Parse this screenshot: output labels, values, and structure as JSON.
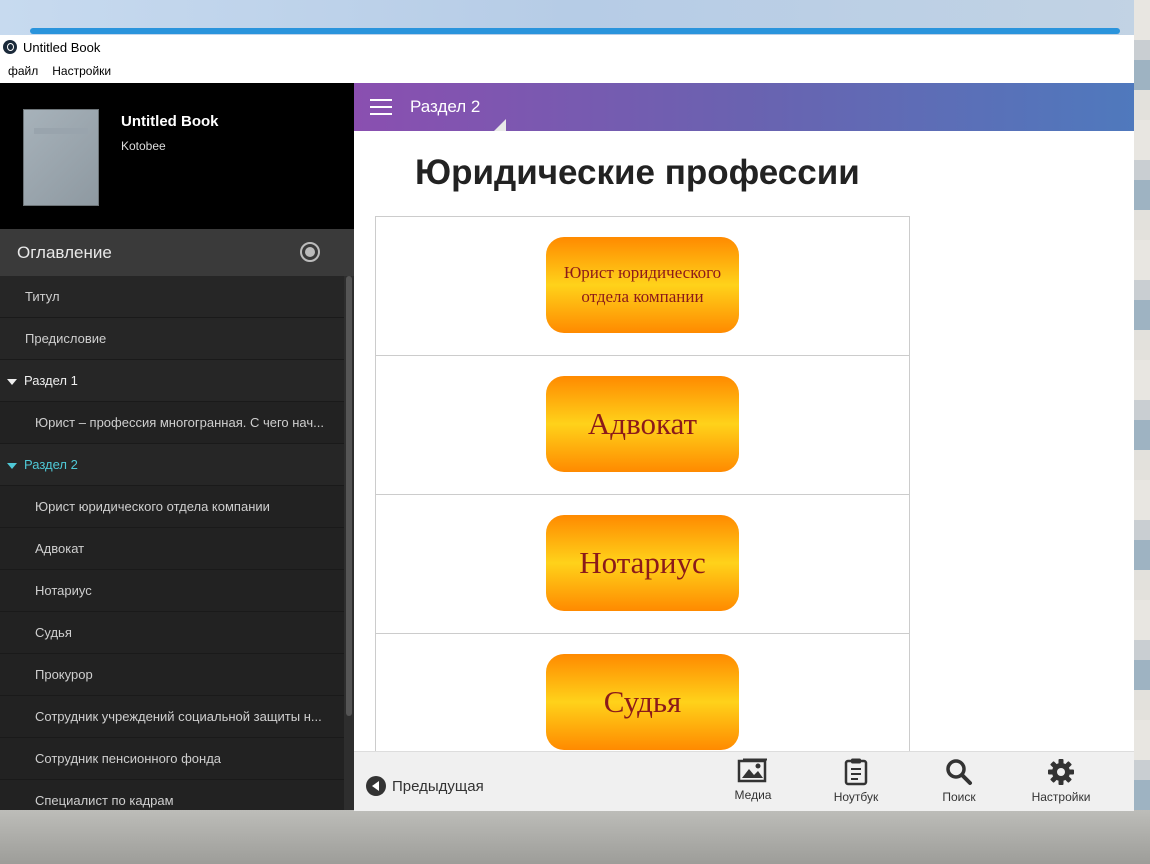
{
  "window": {
    "title": "Untitled Book"
  },
  "menu": [
    "файл",
    "Настройки"
  ],
  "book": {
    "title": "Untitled Book",
    "author": "Kotobee"
  },
  "toc": {
    "heading": "Оглавление",
    "items": [
      {
        "label": "Титул",
        "level": "top"
      },
      {
        "label": "Предисловие",
        "level": "top"
      },
      {
        "label": "Раздел 1",
        "level": "section"
      },
      {
        "label": "Юрист – профессия многогранная. С чего нач...",
        "level": "sub"
      },
      {
        "label": "Раздел 2",
        "level": "section-active"
      },
      {
        "label": "Юрист юридического отдела компании",
        "level": "sub"
      },
      {
        "label": "Адвокат",
        "level": "sub"
      },
      {
        "label": "Нотариус",
        "level": "sub"
      },
      {
        "label": "Судья",
        "level": "sub"
      },
      {
        "label": "Прокурор",
        "level": "sub"
      },
      {
        "label": "Сотрудник учреждений социальной защиты н...",
        "level": "sub"
      },
      {
        "label": "Сотрудник пенсионного фонда",
        "level": "sub"
      },
      {
        "label": "Специалист по кадрам",
        "level": "sub"
      }
    ]
  },
  "header": {
    "section": "Раздел 2"
  },
  "page": {
    "title": "Юридические профессии",
    "cards": [
      "Юрист юридического отдела компании",
      "Адвокат",
      "Нотариус",
      "Судья"
    ]
  },
  "footer": {
    "prev": "Предыдущая",
    "media": "Медиа",
    "notebook": "Ноутбук",
    "search": "Поиск",
    "settings": "Настройки"
  },
  "colors": {
    "header_start": "#8a4fb0",
    "header_end": "#4f79bd",
    "active_section": "#4fc8d6",
    "card_orange": "#ff8a00",
    "card_yellow": "#ffd21a",
    "card_text": "#8b1a1a"
  }
}
